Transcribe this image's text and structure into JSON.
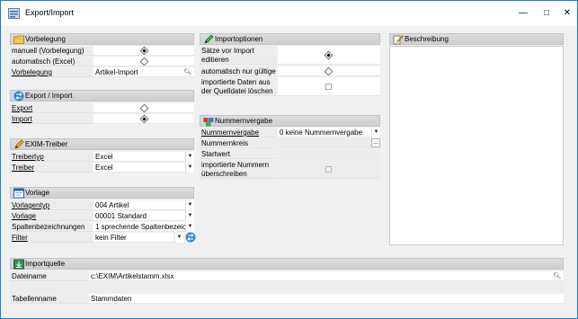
{
  "window": {
    "title": "Export/Import",
    "minimize": "—",
    "maximize": "□",
    "close": "✕"
  },
  "vorbelegung": {
    "title": "Vorbelegung",
    "rows": [
      {
        "label": "manuell (Vorbelegung)",
        "selected": true
      },
      {
        "label": "automatisch (Excel)",
        "selected": false
      }
    ],
    "vorbelegung_label": "Vorbelegung",
    "vorbelegung_value": "Artikel-Import"
  },
  "export_import": {
    "title": "Export / Import",
    "export_label": "Export",
    "import_label": "Import"
  },
  "exim_treiber": {
    "title": "EXIM-Treiber",
    "treibertyp_label": "Treibertyp",
    "treibertyp_value": "Excel",
    "treiber_label": "Treiber",
    "treiber_value": "Excel"
  },
  "vorlage": {
    "title": "Vorlage",
    "vorlagentyp_label": "Vorlagentyp",
    "vorlagentyp_value": "004 Artikel",
    "vorlage_label": "Vorlage",
    "vorlage_value": "00001 Standard",
    "spalten_label": "Spaltenbezeichnungen",
    "spalten_value": "1 sprechende Spaltenbezeic",
    "filter_label": "Filter",
    "filter_value": "kein Filter"
  },
  "importoptionen": {
    "title": "Importoptionen",
    "saetze_label": "Sätze vor Import editieren",
    "automatisch_label": "automatisch nur gültige",
    "loeschen_label": "importierte Daten aus der Quelldatei löschen"
  },
  "nummernvergabe": {
    "title": "Nummernvergabe",
    "nummernvergabe_label": "Nummernvergabe",
    "nummernvergabe_value": "0 keine Nummernvergabe",
    "nummernkreis_label": "Nummernkreis",
    "nummernkreis_button": "...",
    "startwert_label": "Startwert",
    "ueberschreiben_label": "importierte Nummern überschreiben"
  },
  "beschreibung": {
    "title": "Beschreibung"
  },
  "importquelle": {
    "title": "Importquelle",
    "dateiname_label": "Dateiname",
    "dateiname_value": "c:\\EXIM\\Artikelstamm.xlsx",
    "tabellenname_label": "Tabellenname",
    "tabellenname_value": "Stammdaten"
  }
}
